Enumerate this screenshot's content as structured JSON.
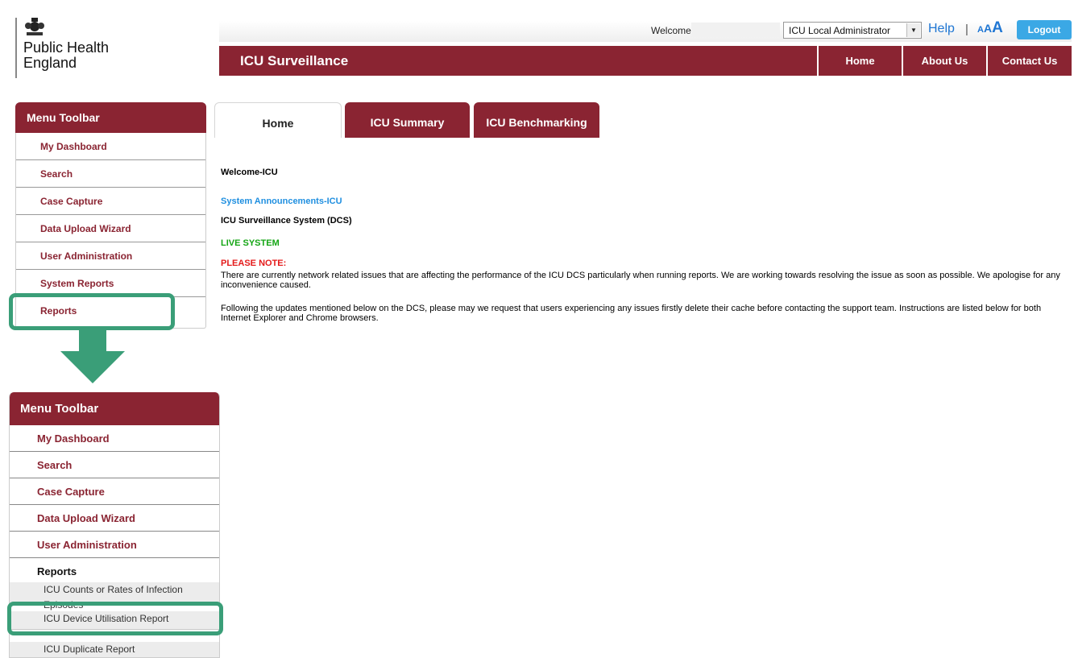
{
  "logo": {
    "line1": "Public Health",
    "line2": "England"
  },
  "header": {
    "welcome_label": "Welcome",
    "role_selected": "ICU Local Administrator",
    "help_label": "Help",
    "separator": "|",
    "text_size": [
      "A",
      "A",
      "A"
    ],
    "logout_label": "Logout",
    "app_title": "ICU Surveillance",
    "nav": [
      "Home",
      "About Us",
      "Contact Us"
    ]
  },
  "sidebar": {
    "title": "Menu Toolbar",
    "items": [
      "My Dashboard",
      "Search",
      "Case Capture",
      "Data Upload Wizard",
      "User Administration",
      "System Reports",
      "Reports"
    ]
  },
  "tabs": [
    "Home",
    "ICU Summary",
    "ICU Benchmarking"
  ],
  "content": {
    "welcome": "Welcome-ICU",
    "announcements_title": "System Announcements-ICU",
    "system_title": "ICU Surveillance System (DCS)",
    "live": "LIVE SYSTEM",
    "please_note": "PLEASE NOTE:",
    "para1": "There are currently network related issues that are affecting the performance of the ICU DCS particularly when running reports. We are working towards resolving the issue as soon as possible. We apologise for any inconvenience caused.",
    "para2": "Following the updates mentioned below on the DCS, please may we request that users experiencing any issues firstly delete their cache before contacting the support team. Instructions are listed below for both Internet Explorer and Chrome browsers."
  },
  "sidebar_expanded": {
    "title": "Menu Toolbar",
    "items": [
      "My Dashboard",
      "Search",
      "Case Capture",
      "Data Upload Wizard",
      "User Administration",
      "Reports"
    ],
    "report_items": [
      "ICU Counts or Rates of Infection Episodes",
      "ICU Device Utilisation Report",
      "ICU Duplicate Report"
    ]
  },
  "colors": {
    "brand_maroon": "#8a2432",
    "link_blue": "#1f8fe0",
    "live_green": "#14a514",
    "note_red": "#e41a1a",
    "highlight_green": "#3a9e78",
    "logout_blue": "#3ba8e5"
  },
  "icons": {
    "crest": "royal-crest-icon",
    "dropdown": "chevron-down-icon",
    "arrow": "down-arrow-icon"
  }
}
